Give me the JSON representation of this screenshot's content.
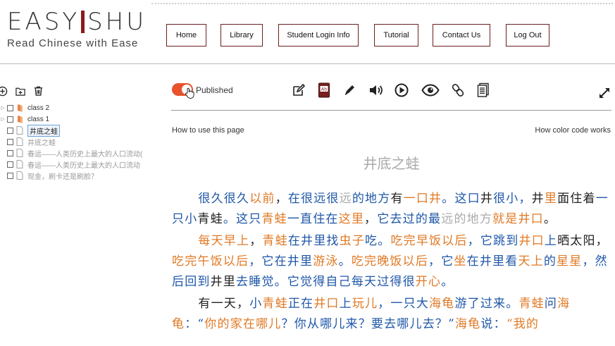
{
  "brand": {
    "left": "EASY",
    "right": "SHU",
    "tagline": "Read Chinese with Ease"
  },
  "nav": [
    {
      "label": "Home"
    },
    {
      "label": "Library"
    },
    {
      "label": "Student Login Info"
    },
    {
      "label": "Tutorial"
    },
    {
      "label": "Contact Us"
    },
    {
      "label": "Log Out"
    }
  ],
  "tree": [
    {
      "label": "class 2",
      "type": "folder"
    },
    {
      "label": "class 1",
      "type": "folder"
    },
    {
      "label": "井底之蛙",
      "type": "doc",
      "selected": true
    },
    {
      "label": "井底之蛙",
      "type": "doc"
    },
    {
      "label": "春运——人类历史上最大的人口流动(",
      "type": "doc"
    },
    {
      "label": "春运——人类历史上最大的人口流动",
      "type": "doc"
    },
    {
      "label": "现金，刷卡还是刷脸？",
      "type": "doc"
    }
  ],
  "toolbar": {
    "published_label": "Published",
    "published": true
  },
  "help": {
    "left": "How to use this page",
    "right": "How color code works"
  },
  "document": {
    "title": "井底之蛙",
    "paragraphs": [
      [
        [
          "b",
          "很久很久"
        ],
        [
          "o",
          "以前"
        ],
        [
          "k",
          "，"
        ],
        [
          "b",
          "在很远很"
        ],
        [
          "g",
          "远"
        ],
        [
          "b",
          "的地方"
        ],
        [
          "k",
          "有"
        ],
        [
          "o",
          "一口井"
        ],
        [
          "b",
          "。这口"
        ],
        [
          "k",
          "井"
        ],
        [
          "b",
          "很小，"
        ],
        [
          "k",
          "井"
        ],
        [
          "o",
          "里"
        ],
        [
          "k",
          "面住着"
        ],
        [
          "b",
          "一只小"
        ],
        [
          "k",
          "青蛙"
        ],
        [
          "b",
          "。这只"
        ],
        [
          "o",
          "青蛙"
        ],
        [
          "b",
          "一直住在"
        ],
        [
          "o",
          "这里"
        ],
        [
          "k",
          "，"
        ],
        [
          "b",
          "它去过的最"
        ],
        [
          "g",
          "远的地方"
        ],
        [
          "o",
          "就是井口"
        ],
        [
          "k",
          "。"
        ]
      ],
      [
        [
          "o",
          "每天早上"
        ],
        [
          "k",
          "，"
        ],
        [
          "o",
          "青蛙"
        ],
        [
          "b",
          "在井里找"
        ],
        [
          "o",
          "虫子"
        ],
        [
          "b",
          "吃。"
        ],
        [
          "o",
          "吃完早饭以后"
        ],
        [
          "b",
          "，它跳到"
        ],
        [
          "o",
          "井口"
        ],
        [
          "b",
          "上"
        ],
        [
          "k",
          "晒太阳，"
        ],
        [
          "o",
          "吃完午饭以后"
        ],
        [
          "b",
          "，它在井里"
        ],
        [
          "o",
          "游泳"
        ],
        [
          "b",
          "。"
        ],
        [
          "o",
          "吃完晚饭以后"
        ],
        [
          "b",
          "，它"
        ],
        [
          "o",
          "坐"
        ],
        [
          "b",
          "在井里看"
        ],
        [
          "o",
          "天上"
        ],
        [
          "b",
          "的"
        ],
        [
          "o",
          "星星"
        ],
        [
          "b",
          "，然后回到"
        ],
        [
          "k",
          "井里"
        ],
        [
          "b",
          "去睡觉。它觉得自己每天过得很"
        ],
        [
          "o",
          "开心"
        ],
        [
          "b",
          "。"
        ]
      ],
      [
        [
          "k",
          "有一天，"
        ],
        [
          "b",
          "小"
        ],
        [
          "o",
          "青蛙"
        ],
        [
          "b",
          "正在"
        ],
        [
          "o",
          "井口"
        ],
        [
          "b",
          "上"
        ],
        [
          "o",
          "玩儿"
        ],
        [
          "b",
          "，一只大"
        ],
        [
          "o",
          "海龟"
        ],
        [
          "b",
          "游了过来。"
        ],
        [
          "o",
          "青蛙"
        ],
        [
          "b",
          "问"
        ],
        [
          "o",
          "海龟"
        ],
        [
          "b",
          "：“"
        ],
        [
          "o",
          "你的家在哪儿"
        ],
        [
          "b",
          "？你从哪儿来？要去哪儿去？”"
        ],
        [
          "o",
          "海龟"
        ],
        [
          "b",
          "说："
        ],
        [
          "o",
          "“我的"
        ]
      ]
    ]
  }
}
